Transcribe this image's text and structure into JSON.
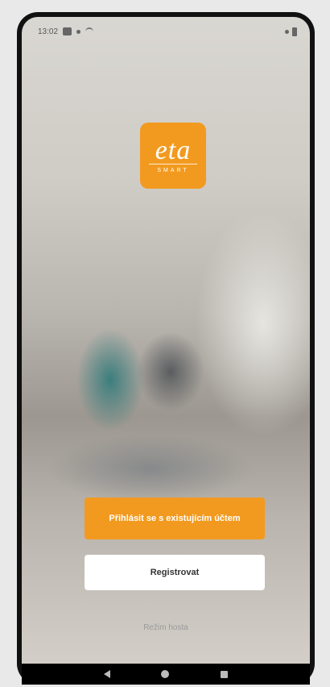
{
  "status_bar": {
    "time": "13:02"
  },
  "logo": {
    "main": "eta",
    "sub": "SMART"
  },
  "buttons": {
    "login_label": "Přihlásit se s existujícím účtem",
    "register_label": "Registrovat",
    "guest_label": "Režim hosta"
  },
  "colors": {
    "accent": "#f29a1f",
    "background": "#e9e9e9",
    "nav_bar": "#000000"
  },
  "icons": {
    "notification": "app-notification-icon",
    "dot": "dot-icon",
    "wifi": "wifi-icon",
    "location": "location-icon",
    "battery": "battery-icon",
    "back": "back-triangle-icon",
    "home": "home-circle-icon",
    "recent": "recent-square-icon"
  }
}
